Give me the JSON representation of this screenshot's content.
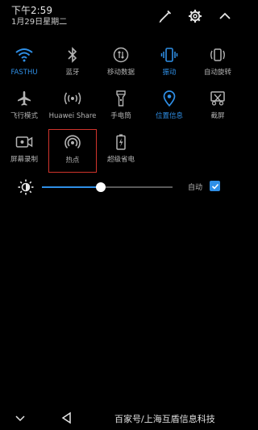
{
  "status": {
    "time": "下午2:59",
    "date": "1月29日星期二"
  },
  "top_actions": [
    {
      "name": "edit-icon"
    },
    {
      "name": "settings-icon"
    },
    {
      "name": "collapse-icon"
    }
  ],
  "tiles_row1": [
    {
      "label": "FASTHU",
      "icon": "wifi-icon",
      "on": true
    },
    {
      "label": "蓝牙",
      "icon": "bluetooth-icon",
      "on": false
    },
    {
      "label": "移动数据",
      "icon": "mobile-data-icon",
      "on": false
    },
    {
      "label": "振动",
      "icon": "vibrate-icon",
      "on": true
    },
    {
      "label": "自动旋转",
      "icon": "auto-rotate-icon",
      "on": false
    }
  ],
  "tiles_row2": [
    {
      "label": "飞行模式",
      "icon": "airplane-icon",
      "on": false
    },
    {
      "label": "Huawei Share",
      "icon": "huawei-share-icon",
      "on": false
    },
    {
      "label": "手电筒",
      "icon": "flashlight-icon",
      "on": false
    },
    {
      "label": "位置信息",
      "icon": "location-icon",
      "on": true
    },
    {
      "label": "截屏",
      "icon": "screenshot-icon",
      "on": false
    }
  ],
  "tiles_row3": [
    {
      "label": "屏幕录制",
      "icon": "screen-record-icon",
      "on": false
    },
    {
      "label": "热点",
      "icon": "hotspot-icon",
      "on": false,
      "highlighted": true
    },
    {
      "label": "超级省电",
      "icon": "battery-saver-icon",
      "on": false
    }
  ],
  "brightness": {
    "level": 0.45,
    "auto_label": "自动",
    "auto_checked": true
  },
  "navbar": {
    "watermark": "百家号/上海互盾信息科技"
  },
  "colors": {
    "accent": "#2f8fe6",
    "highlight_border": "#d0342c",
    "background": "#000000"
  }
}
